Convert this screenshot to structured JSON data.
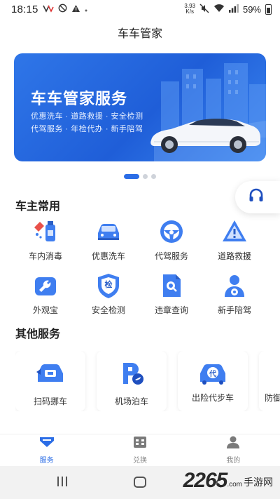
{
  "status_bar": {
    "time": "18:15",
    "net_speed_value": "3.93",
    "net_speed_unit": "K/s",
    "battery": "59%"
  },
  "header": {
    "title": "车车管家"
  },
  "banner": {
    "title": "车车管家服务",
    "line1": "优惠洗车 · 道路救援 · 安全检测",
    "line2": "代驾服务 · 年检代办 · 新手陪驾",
    "active_slide": 1,
    "slide_count": 3
  },
  "owner_services": {
    "title": "车主常用",
    "items": [
      {
        "label": "车内消毒",
        "icon": "disinfect-icon"
      },
      {
        "label": "优惠洗车",
        "icon": "car-wash-icon"
      },
      {
        "label": "代驾服务",
        "icon": "steering-wheel-icon"
      },
      {
        "label": "道路救援",
        "icon": "warning-triangle-icon"
      },
      {
        "label": "外观宝",
        "icon": "wrench-icon"
      },
      {
        "label": "安全检测",
        "icon": "shield-check-icon",
        "badge": "检"
      },
      {
        "label": "违章查询",
        "icon": "document-search-icon"
      },
      {
        "label": "新手陪驾",
        "icon": "driver-icon"
      }
    ]
  },
  "other_services": {
    "title": "其他服务",
    "items": [
      {
        "label": "扫码挪车",
        "icon": "scan-car-icon"
      },
      {
        "label": "机场泊车",
        "icon": "parking-plane-icon"
      },
      {
        "label": "出险代步车",
        "icon": "replacement-car-icon",
        "badge": "代"
      },
      {
        "label": "防御",
        "icon": "partial-card-icon"
      }
    ]
  },
  "tabbar": {
    "items": [
      {
        "label": "服务",
        "icon": "service-icon",
        "active": true
      },
      {
        "label": "兑换",
        "icon": "exchange-icon",
        "active": false
      },
      {
        "label": "我的",
        "icon": "profile-icon",
        "active": false
      }
    ]
  },
  "watermark": {
    "number": "2265",
    "suffix": ".com",
    "text": "手游网"
  },
  "colors": {
    "accent": "#2b6de6",
    "banner": "#2468e0"
  }
}
